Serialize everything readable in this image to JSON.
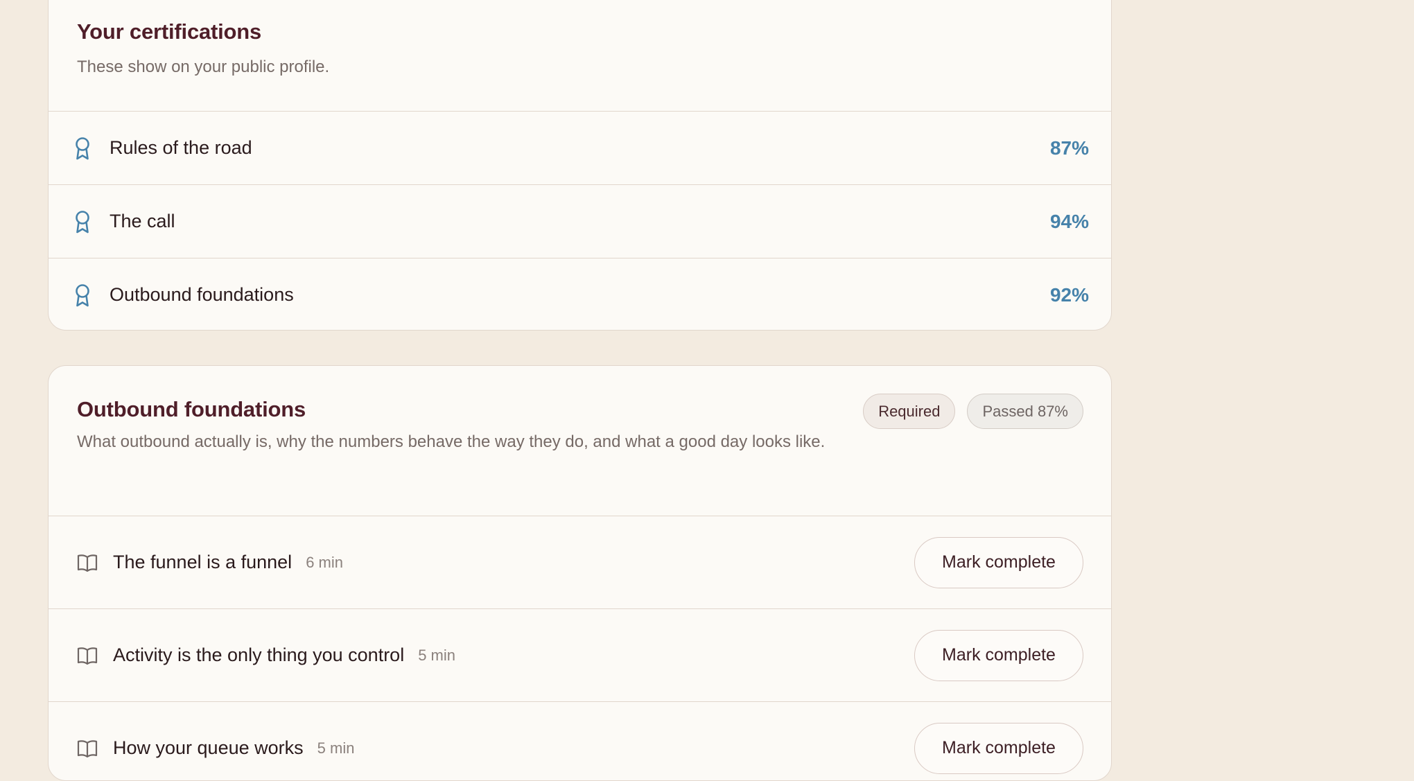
{
  "certifications": {
    "title": "Your certifications",
    "subtitle": "These show on your public profile.",
    "items": [
      {
        "label": "Rules of the road",
        "score": "87%"
      },
      {
        "label": "The call",
        "score": "94%"
      },
      {
        "label": "Outbound foundations",
        "score": "92%"
      }
    ]
  },
  "course": {
    "title": "Outbound foundations",
    "description": "What outbound actually is, why the numbers behave the way they do, and what a good day looks like.",
    "badges": {
      "required": "Required",
      "passed": "Passed 87%"
    },
    "lessons": [
      {
        "title": "The funnel is a funnel",
        "duration": "6 min",
        "action": "Mark complete"
      },
      {
        "title": "Activity is the only thing you control",
        "duration": "5 min",
        "action": "Mark complete"
      },
      {
        "title": "How your queue works",
        "duration": "5 min",
        "action": "Mark complete"
      }
    ]
  },
  "icons": {
    "certification": "ribbon-award-icon",
    "lesson": "open-book-icon"
  },
  "colors": {
    "background": "#f3ebe0",
    "card": "#fcfaf6",
    "title": "#4f1e29",
    "score": "#4682aa"
  }
}
